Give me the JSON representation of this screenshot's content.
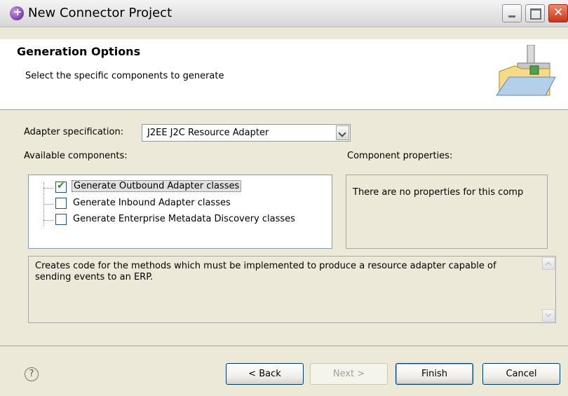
{
  "window": {
    "title": "New Connector Project"
  },
  "header": {
    "title": "Generation Options",
    "subtitle": "Select the specific components to generate"
  },
  "form": {
    "adapter_spec_label": "Adapter specification:",
    "adapter_spec_value": "J2EE J2C Resource Adapter",
    "available_label": "Available components:",
    "properties_label": "Component properties:",
    "components": [
      {
        "label": "Generate Outbound Adapter classes",
        "checked": true,
        "selected": true
      },
      {
        "label": "Generate Inbound Adapter classes",
        "checked": false,
        "selected": false
      },
      {
        "label": "Generate Enterprise Metadata Discovery classes",
        "checked": false,
        "selected": false
      }
    ],
    "properties_text": "There are no properties for this comp",
    "description": "Creates code for the methods which must be implemented to produce a resource adapter capable of sending events to an ERP."
  },
  "buttons": {
    "help": "?",
    "back": "< Back",
    "next": "Next >",
    "finish": "Finish",
    "cancel": "Cancel"
  }
}
